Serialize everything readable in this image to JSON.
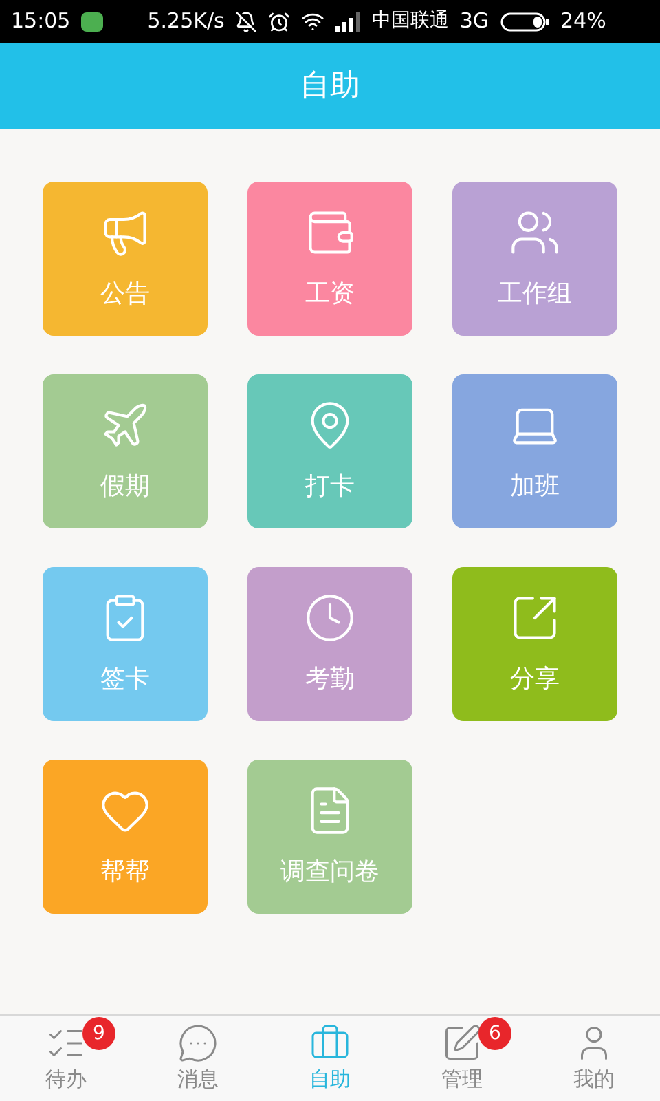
{
  "status_bar": {
    "time": "15:05",
    "speed": "5.25K/s",
    "carrier": "中国联通",
    "network": "3G",
    "battery": "24%"
  },
  "header": {
    "title": "自助"
  },
  "tiles": [
    {
      "label": "公告",
      "color": "#f5b731",
      "kind": "megaphone"
    },
    {
      "label": "工资",
      "color": "#fb87a0",
      "kind": "wallet"
    },
    {
      "label": "工作组",
      "color": "#b9a1d4",
      "kind": "users"
    },
    {
      "label": "假期",
      "color": "#a3cb92",
      "kind": "plane"
    },
    {
      "label": "打卡",
      "color": "#67c8b8",
      "kind": "pin"
    },
    {
      "label": "加班",
      "color": "#86a6df",
      "kind": "desk"
    },
    {
      "label": "签卡",
      "color": "#74c9ef",
      "kind": "clipboard"
    },
    {
      "label": "考勤",
      "color": "#c39ecb",
      "kind": "clock"
    },
    {
      "label": "分享",
      "color": "#8fbc1c",
      "kind": "share"
    },
    {
      "label": "帮帮",
      "color": "#fba625",
      "kind": "hearts"
    },
    {
      "label": "调查问卷",
      "color": "#a3cb92",
      "kind": "survey"
    }
  ],
  "nav": [
    {
      "label": "待办",
      "selected": false,
      "kind": "todo",
      "badge": "9"
    },
    {
      "label": "消息",
      "selected": false,
      "kind": "chat"
    },
    {
      "label": "自助",
      "selected": true,
      "kind": "case"
    },
    {
      "label": "管理",
      "selected": false,
      "kind": "edit",
      "badge": "6"
    },
    {
      "label": "我的",
      "selected": false,
      "kind": "user"
    }
  ]
}
